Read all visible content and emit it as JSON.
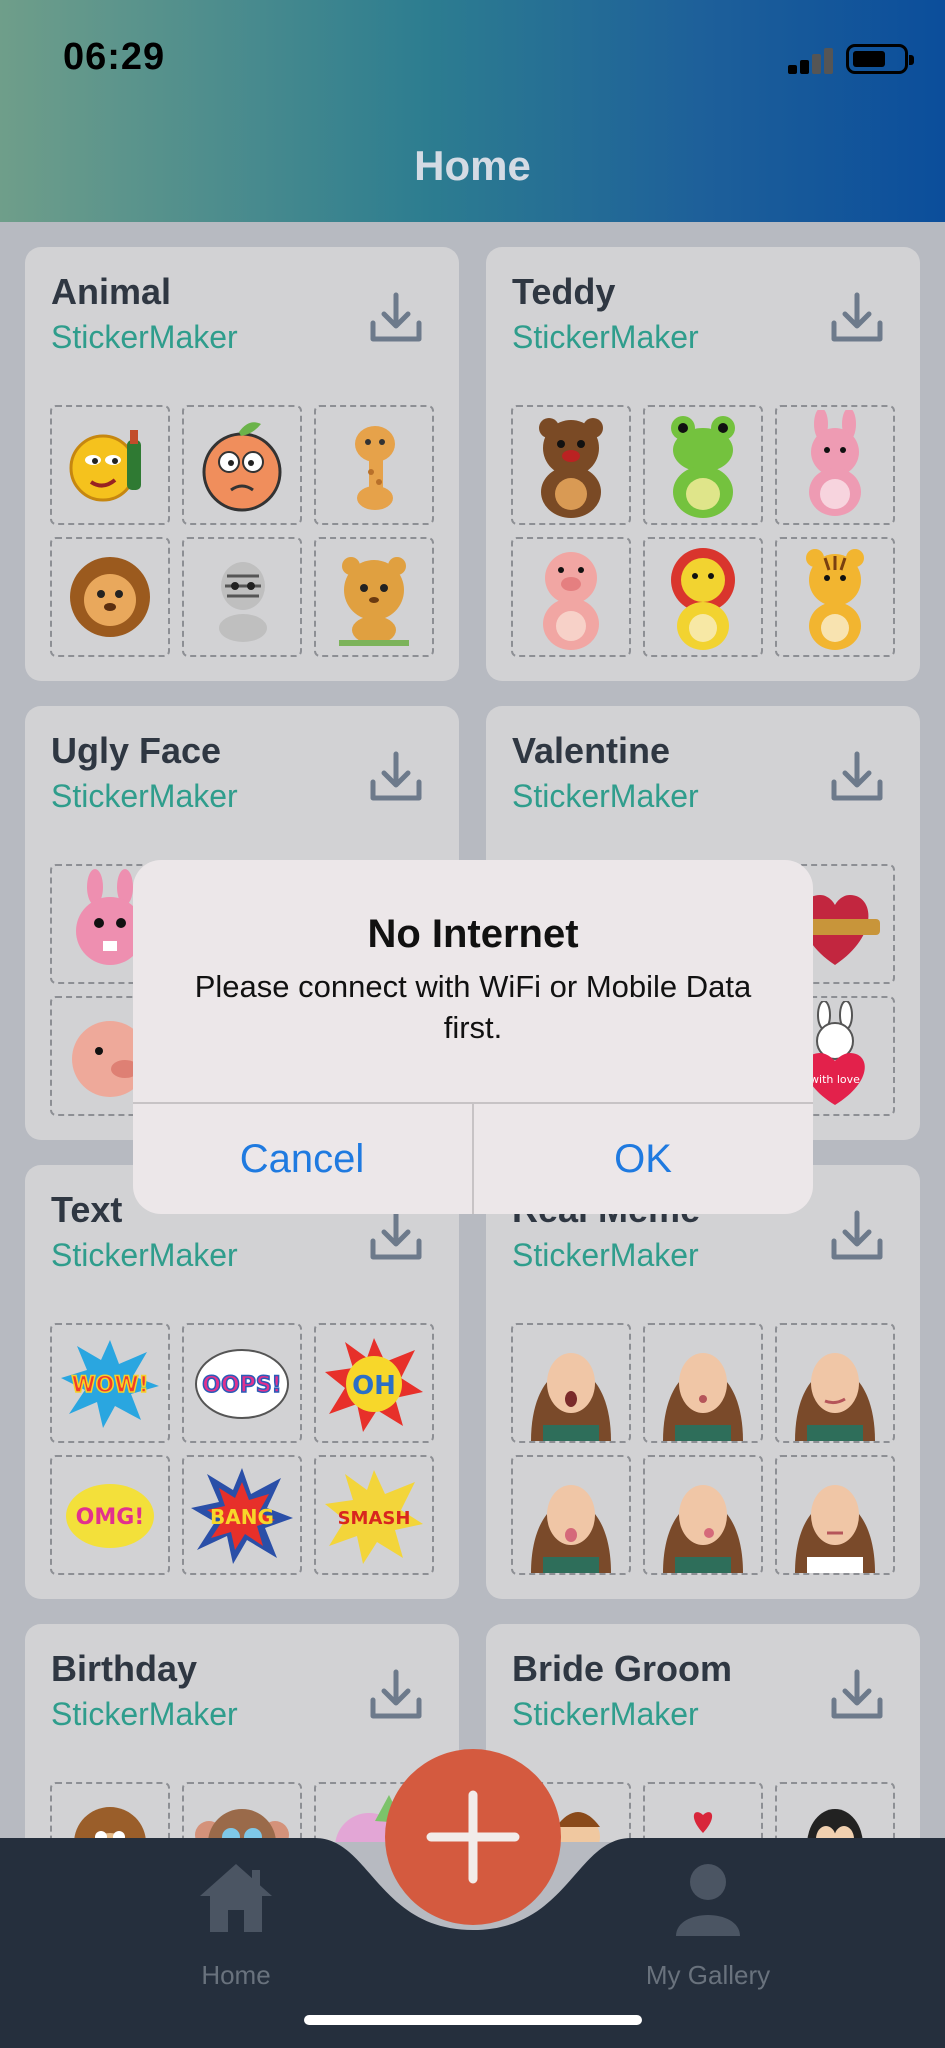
{
  "status_bar": {
    "time": "06:29"
  },
  "header": {
    "title": "Home"
  },
  "packs": [
    {
      "title": "Animal",
      "subtitle": "StickerMaker",
      "stickers": [
        "drunk-emoji",
        "angry-peach",
        "giraffe",
        "lion",
        "zebra",
        "tiger-cub"
      ]
    },
    {
      "title": "Teddy",
      "subtitle": "StickerMaker",
      "stickers": [
        "brown-bear",
        "green-frog",
        "pink-bunny",
        "pink-pig",
        "lion-teddy",
        "tiger-teddy"
      ]
    },
    {
      "title": "Ugly Face",
      "subtitle": "StickerMaker",
      "stickers": [
        "pink-bunny-face",
        "",
        "",
        "pink-pig-face",
        "",
        ""
      ]
    },
    {
      "title": "Valentine",
      "subtitle": "StickerMaker",
      "stickers": [
        "",
        "",
        "rose-heart",
        "",
        "",
        "bunny-with-love"
      ]
    },
    {
      "title": "Text",
      "subtitle": "StickerMaker",
      "stickers": [
        "WOW!",
        "OOPS!",
        "OH",
        "OMG!",
        "BANG",
        "SMASH"
      ]
    },
    {
      "title": "Real Meme",
      "subtitle": "StickerMaker",
      "stickers": [
        "face-surprised",
        "face-kiss",
        "face-wink",
        "face-tongue",
        "face-tongue-side",
        "face-skeptic"
      ]
    },
    {
      "title": "Birthday",
      "subtitle": "StickerMaker",
      "stickers": [
        "monkey-party",
        "monkey-party-2",
        "elephant-party"
      ]
    },
    {
      "title": "Bride Groom",
      "subtitle": "StickerMaker",
      "stickers": [
        "couple-cartoon",
        "wedding-scene",
        "couple-portrait"
      ]
    }
  ],
  "sticker_text": {
    "with_love": "with love"
  },
  "dialog": {
    "title": "No Internet",
    "message": "Please connect with WiFi or Mobile Data first.",
    "cancel_label": "Cancel",
    "ok_label": "OK"
  },
  "tabbar": {
    "home_label": "Home",
    "gallery_label": "My Gallery",
    "fab_icon": "plus-icon"
  },
  "colors": {
    "header_start": "#6f9e8a",
    "header_end": "#0b4e9b",
    "accent_teal": "#2f9d8c",
    "fab": "#d45a3f",
    "dialog_button": "#1f7ae0",
    "tabbar_bg": "#252f3d"
  }
}
